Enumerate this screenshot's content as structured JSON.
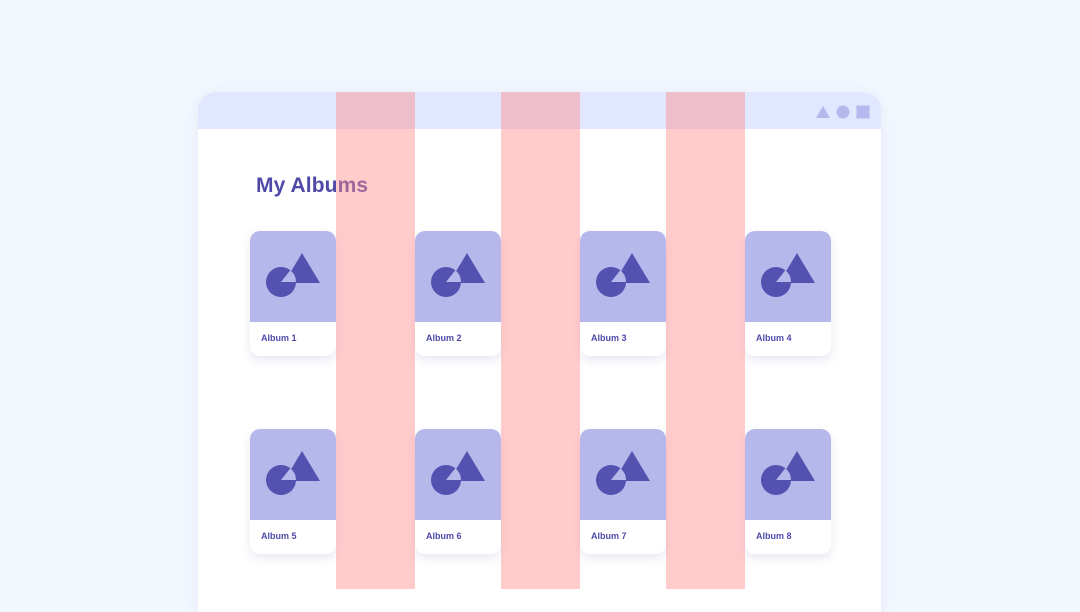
{
  "window": {
    "controls": [
      {
        "name": "triangle-icon"
      },
      {
        "name": "circle-icon"
      },
      {
        "name": "square-icon"
      }
    ]
  },
  "page": {
    "title": "My Albums"
  },
  "albums": [
    {
      "label": "Album 1",
      "cover_icon": "shapes-icon"
    },
    {
      "label": "Album 2",
      "cover_icon": "shapes-icon"
    },
    {
      "label": "Album 3",
      "cover_icon": "shapes-icon"
    },
    {
      "label": "Album 4",
      "cover_icon": "shapes-icon"
    },
    {
      "label": "Album 5",
      "cover_icon": "shapes-icon"
    },
    {
      "label": "Album 6",
      "cover_icon": "shapes-icon"
    },
    {
      "label": "Album 7",
      "cover_icon": "shapes-icon"
    },
    {
      "label": "Album 8",
      "cover_icon": "shapes-icon"
    }
  ],
  "grid_overlay": {
    "gutter_count": 3,
    "color": "#ff8c8c"
  },
  "colors": {
    "background": "#f3f7fe",
    "titlebar": "#e1e7fe",
    "accent": "#4f4aa8",
    "cover": "#b6b8eb",
    "icon": "#5452b0"
  }
}
